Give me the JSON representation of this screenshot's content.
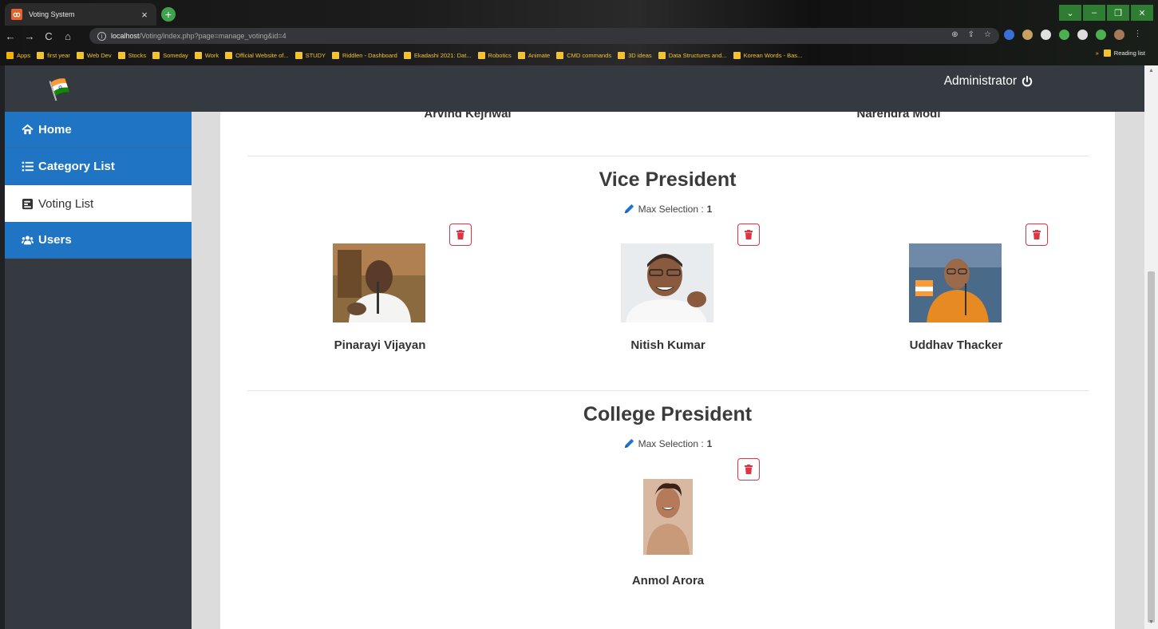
{
  "browser": {
    "tab_title": "Voting System",
    "tab_close": "×",
    "new_tab": "+",
    "url_host": "localhost",
    "url_path": "/Voting/index.php?page=manage_voting&id=4",
    "window_controls": [
      "⌄",
      "–",
      "❐",
      "✕"
    ],
    "nav": {
      "back": "←",
      "forward": "→",
      "reload": "C",
      "home": "⌂"
    },
    "omni_icons": [
      "⊕",
      "⇪",
      "☆"
    ],
    "bookmarks": [
      {
        "label": "Apps"
      },
      {
        "label": "first year"
      },
      {
        "label": "Web Dev"
      },
      {
        "label": "Stocks"
      },
      {
        "label": "Someday"
      },
      {
        "label": "Work"
      },
      {
        "label": "Official Website of..."
      },
      {
        "label": "STUDY"
      },
      {
        "label": "Riddlen - Dashboard"
      },
      {
        "label": "Ekadashi 2021: Dat..."
      },
      {
        "label": "Robotics"
      },
      {
        "label": "Animate"
      },
      {
        "label": "CMD commands"
      },
      {
        "label": "3D ideas"
      },
      {
        "label": "Data Structures and..."
      },
      {
        "label": "Korean Words - Bas..."
      }
    ],
    "bookmarks_more": "»",
    "reading_list": "Reading list",
    "colors": {
      "tab_green": "#3fa34d",
      "bookmark_text": "#f1c232"
    }
  },
  "topbar": {
    "user": "Administrator",
    "logo_icon": "india-flag-icon",
    "power_icon": "power-icon",
    "background": "#343a40"
  },
  "sidebar": {
    "items": [
      {
        "label": "Home",
        "icon": "home-icon",
        "active": false
      },
      {
        "label": "Category List",
        "icon": "list-icon",
        "active": false
      },
      {
        "label": "Voting List",
        "icon": "poll-icon",
        "active": true
      },
      {
        "label": "Users",
        "icon": "users-icon",
        "active": false
      }
    ],
    "accent": "#1f74c4"
  },
  "previous_section": {
    "candidates": [
      "Arvind Kejriwal",
      "Narendra Modi"
    ]
  },
  "sections": [
    {
      "title": "Vice President",
      "max_label": "Max Selection : ",
      "max_value": "1",
      "candidates": [
        {
          "name": "Pinarayi Vijayan"
        },
        {
          "name": "Nitish Kumar"
        },
        {
          "name": "Uddhav Thacker"
        }
      ]
    },
    {
      "title": "College President",
      "max_label": "Max Selection : ",
      "max_value": "1",
      "candidates": [
        {
          "name": "Anmol Arora"
        }
      ]
    }
  ],
  "delete_color": "#dc3545"
}
